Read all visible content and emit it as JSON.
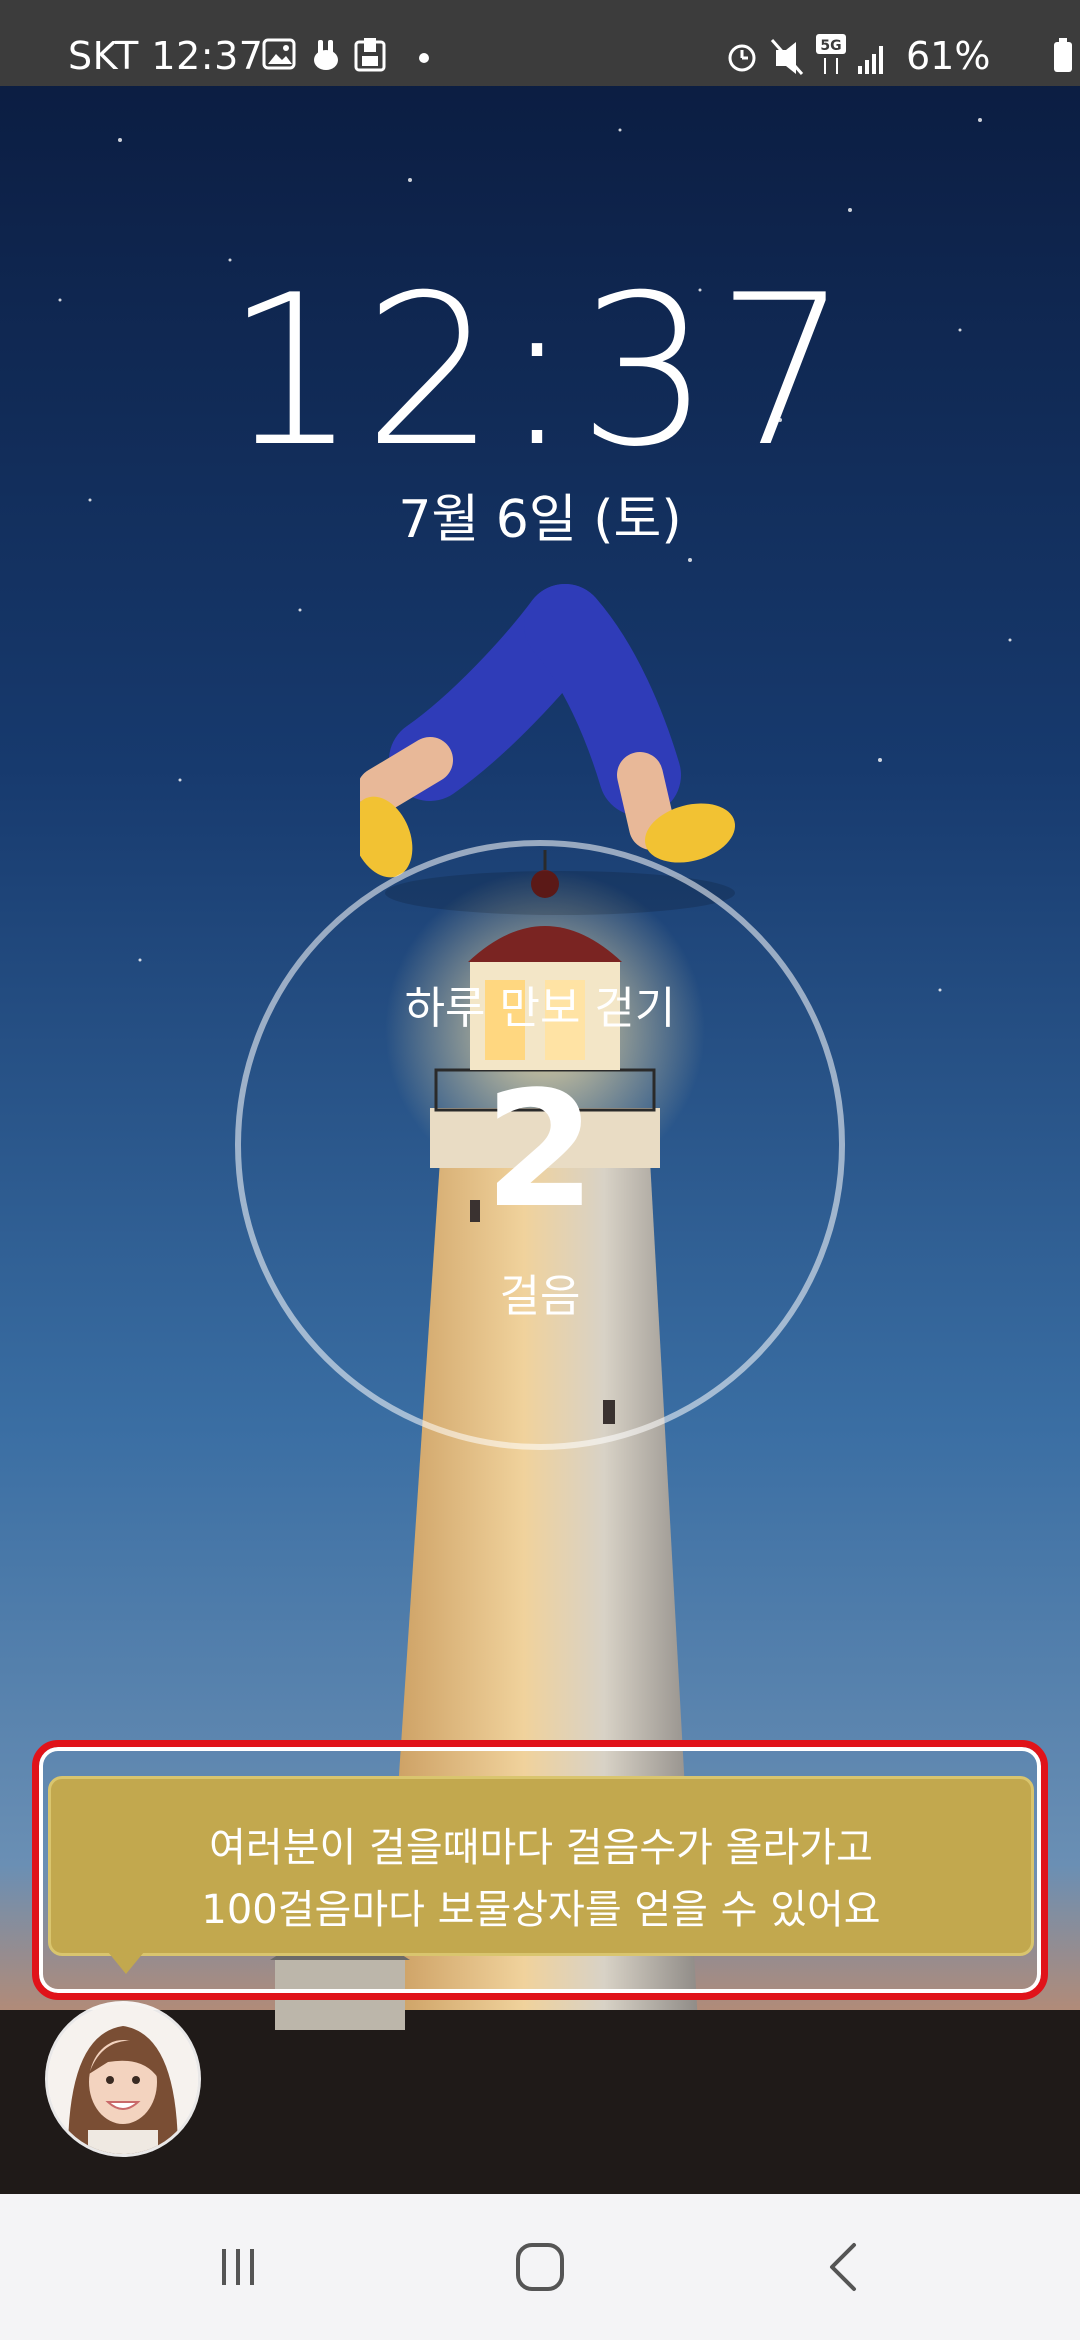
{
  "status_bar": {
    "carrier": "SKT",
    "time": "12:37",
    "battery": "61%",
    "network": "5G",
    "icons_left": [
      "gallery-icon",
      "rabbit-icon",
      "phone-card-icon",
      "dot-icon"
    ],
    "icons_right": [
      "alarm-icon",
      "mute-icon",
      "5g-icon",
      "signal-icon",
      "battery-icon"
    ]
  },
  "lockscreen": {
    "time": "12:37",
    "date": "7월 6일 (토)"
  },
  "steps": {
    "title": "하루 만보 걷기",
    "count": "2",
    "unit": "걸음"
  },
  "bubble": {
    "line1": "여러분이 걸을때마다 걸음수가 올라가고",
    "line2": "100걸음마다 보물상자를 얻을 수 있어요"
  },
  "nav": {
    "recents": "recents-icon",
    "home": "home-icon",
    "back": "back-icon"
  },
  "colors": {
    "status_bar": "#3c3c3c",
    "bubble": "#c2a84e",
    "highlight": "#e0131a",
    "pants": "#2f3cb8",
    "shoes": "#f2c233",
    "nav_bar": "#f4f4f6"
  }
}
